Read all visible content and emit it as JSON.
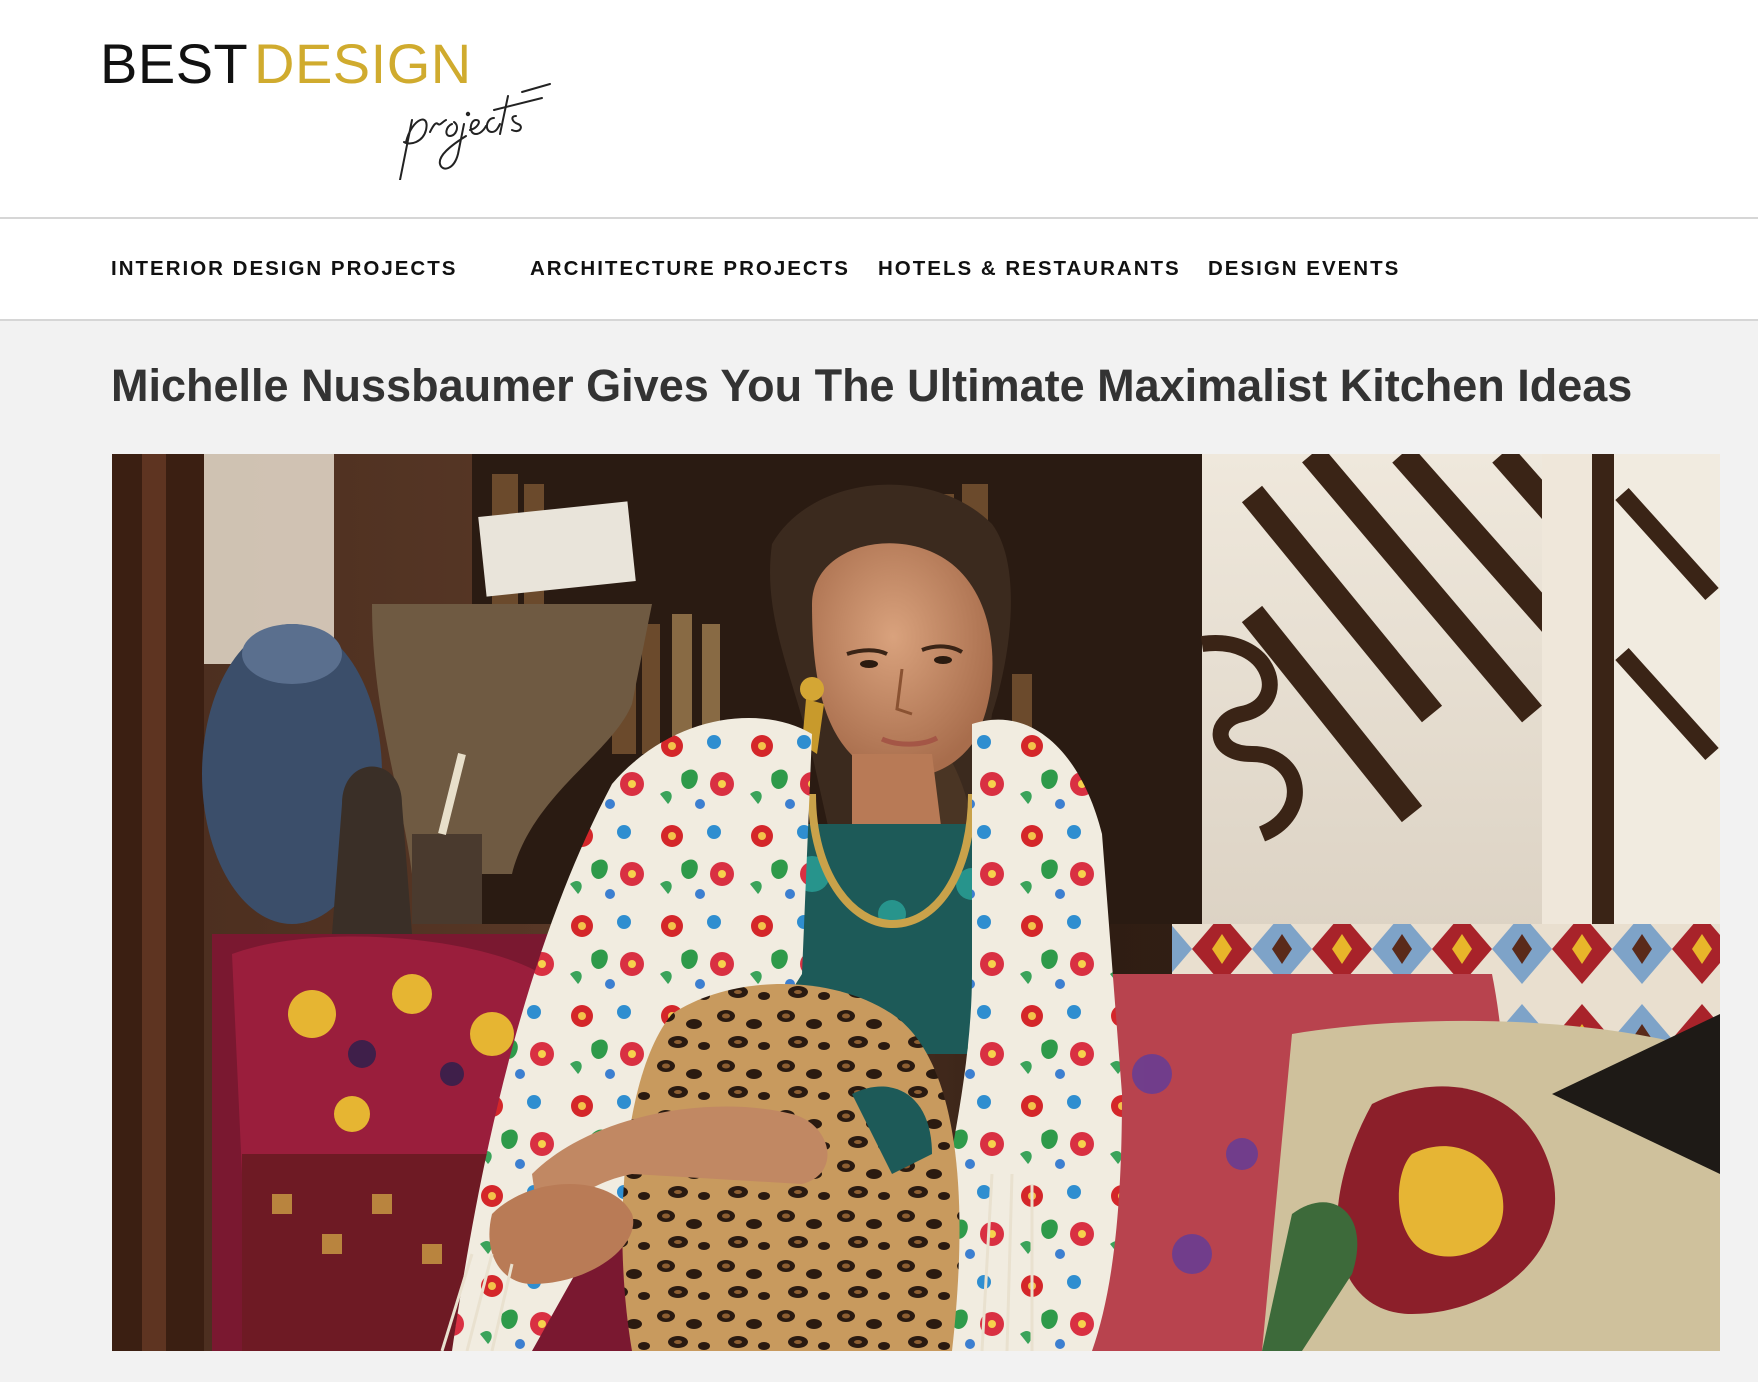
{
  "brand": {
    "word_1": "BEST",
    "word_2": "DESIGN",
    "script_word": "projects",
    "word_1_color": "#111111",
    "word_2_color": "#d0ab2e"
  },
  "nav": {
    "items": [
      {
        "label": "INTERIOR DESIGN PROJECTS"
      },
      {
        "label": "ARCHITECTURE PROJECTS"
      },
      {
        "label": "HOTELS & RESTAURANTS"
      },
      {
        "label": "DESIGN EVENTS"
      }
    ]
  },
  "article": {
    "title": "Michelle Nussbaumer Gives You The Ultimate Maximalist Kitchen Ideas"
  },
  "colors": {
    "page_background": "#f2f2f2",
    "header_background": "#ffffff",
    "title_text": "#333333"
  }
}
